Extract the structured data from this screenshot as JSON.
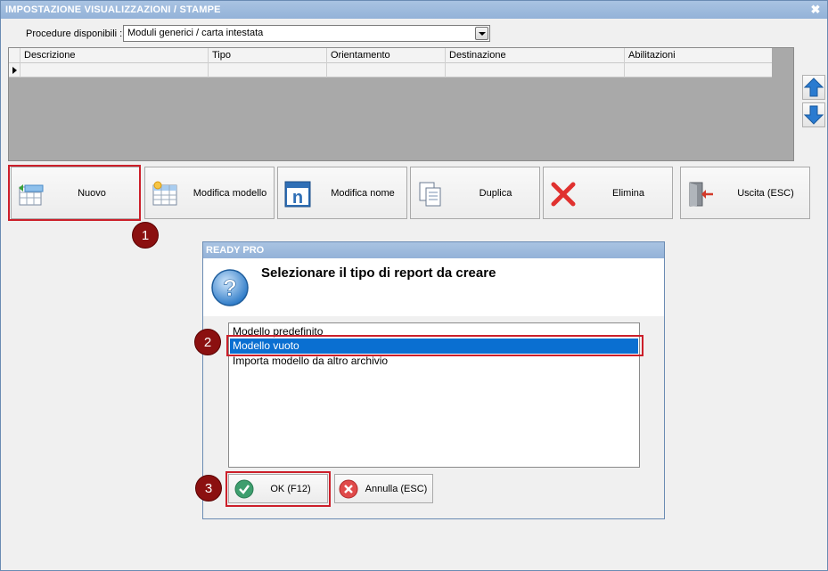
{
  "window": {
    "title": "IMPOSTAZIONE VISUALIZZAZIONI / STAMPE",
    "close_glyph": "✖"
  },
  "procedure": {
    "label": "Procedure disponibili :",
    "value": "Moduli generici / carta intestata"
  },
  "grid": {
    "columns": [
      "Descrizione",
      "Tipo",
      "Orientamento",
      "Destinazione",
      "Abilitazioni"
    ]
  },
  "toolbar": {
    "buttons": [
      {
        "label": "Nuovo",
        "icon": "new-grid-icon"
      },
      {
        "label": "Modifica modello",
        "icon": "edit-grid-icon"
      },
      {
        "label": "Modifica nome",
        "icon": "rename-icon"
      },
      {
        "label": "Duplica",
        "icon": "duplicate-icon"
      },
      {
        "label": "Elimina",
        "icon": "delete-x-icon"
      },
      {
        "label": "Uscita (ESC)",
        "icon": "exit-door-icon"
      }
    ]
  },
  "side_buttons": [
    {
      "icon": "arrow-up-icon"
    },
    {
      "icon": "arrow-down-icon"
    }
  ],
  "badges": [
    "1",
    "2",
    "3"
  ],
  "dialog": {
    "title": "READY PRO",
    "message": "Selezionare il tipo di report da creare",
    "icon": "question-icon",
    "options": [
      "Modello predefinito",
      "Modello vuoto",
      "Importa modello da altro archivio"
    ],
    "selected_index": 1,
    "ok_label": "OK (F12)",
    "cancel_label": "Annulla (ESC)"
  },
  "colors": {
    "accent_red": "#cc1f2a",
    "badge": "#8b1010",
    "selection": "#0a6fd1",
    "title_bar": "#9bb9dd"
  }
}
